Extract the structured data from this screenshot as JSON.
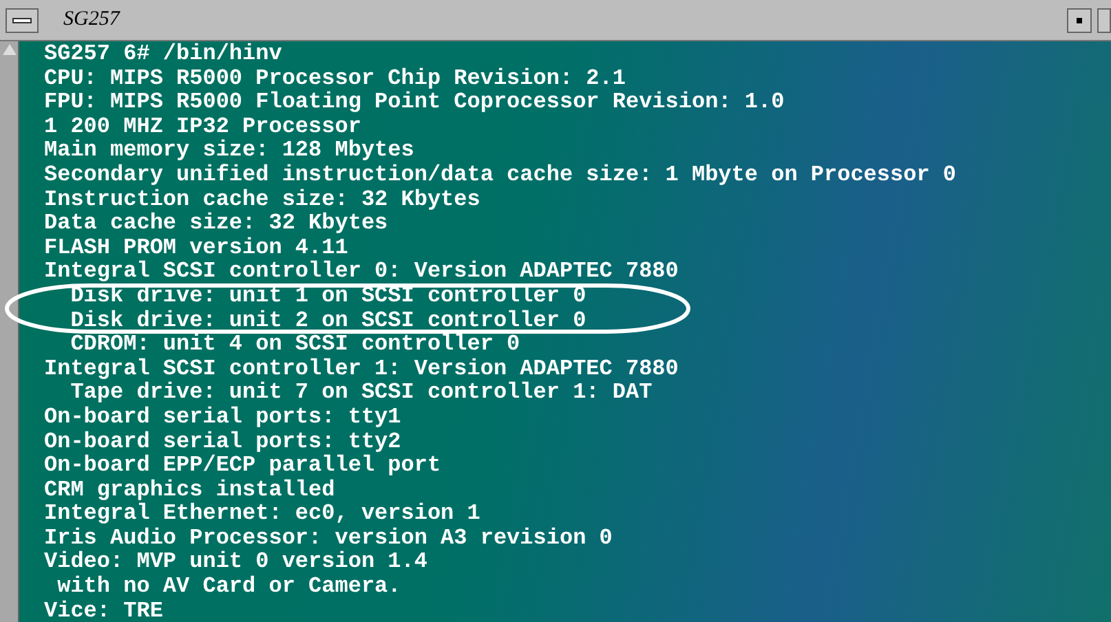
{
  "window": {
    "title": "SG257"
  },
  "terminal": {
    "lines": [
      "SG257 6# /bin/hinv",
      "CPU: MIPS R5000 Processor Chip Revision: 2.1",
      "FPU: MIPS R5000 Floating Point Coprocessor Revision: 1.0",
      "1 200 MHZ IP32 Processor",
      "Main memory size: 128 Mbytes",
      "Secondary unified instruction/data cache size: 1 Mbyte on Processor 0",
      "Instruction cache size: 32 Kbytes",
      "Data cache size: 32 Kbytes",
      "FLASH PROM version 4.11",
      "Integral SCSI controller 0: Version ADAPTEC 7880",
      "  Disk drive: unit 1 on SCSI controller 0",
      "  Disk drive: unit 2 on SCSI controller 0",
      "  CDROM: unit 4 on SCSI controller 0",
      "Integral SCSI controller 1: Version ADAPTEC 7880",
      "  Tape drive: unit 7 on SCSI controller 1: DAT",
      "On-board serial ports: tty1",
      "On-board serial ports: tty2",
      "On-board EPP/ECP parallel port",
      "CRM graphics installed",
      "Integral Ethernet: ec0, version 1",
      "Iris Audio Processor: version A3 revision 0",
      "Video: MVP unit 0 version 1.4",
      " with no AV Card or Camera.",
      "Vice: TRE"
    ]
  }
}
